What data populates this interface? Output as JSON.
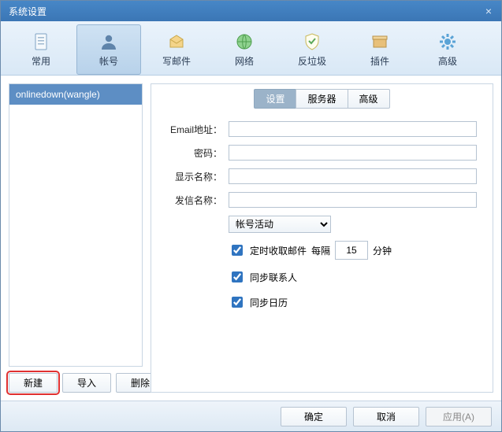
{
  "window": {
    "title": "系统设置"
  },
  "toolbar": {
    "items": [
      {
        "label": "常用"
      },
      {
        "label": "帐号"
      },
      {
        "label": "写邮件"
      },
      {
        "label": "网络"
      },
      {
        "label": "反垃圾"
      },
      {
        "label": "插件"
      },
      {
        "label": "高级"
      }
    ],
    "active_index": 1
  },
  "accounts": {
    "items": [
      {
        "label": "onlinedown(wangle)"
      }
    ],
    "selected_index": 0,
    "actions": {
      "new": "新建",
      "import": "导入",
      "delete": "删除"
    }
  },
  "subtabs": {
    "items": [
      "设置",
      "服务器",
      "高级"
    ],
    "active_index": 0
  },
  "form": {
    "email_label": "Email地址：",
    "email_value": "",
    "password_label": "密码：",
    "password_value": "",
    "display_label": "显示名称：",
    "display_value": "",
    "sender_label": "发信名称：",
    "sender_value": "",
    "activity_select": "帐号活动",
    "autocheck_label": "定时收取邮件",
    "every_label": "每隔",
    "interval_value": "15",
    "minutes_label": "分钟",
    "sync_contacts_label": "同步联系人",
    "sync_calendar_label": "同步日历"
  },
  "footer": {
    "ok": "确定",
    "cancel": "取消",
    "apply": "应用(A)"
  }
}
